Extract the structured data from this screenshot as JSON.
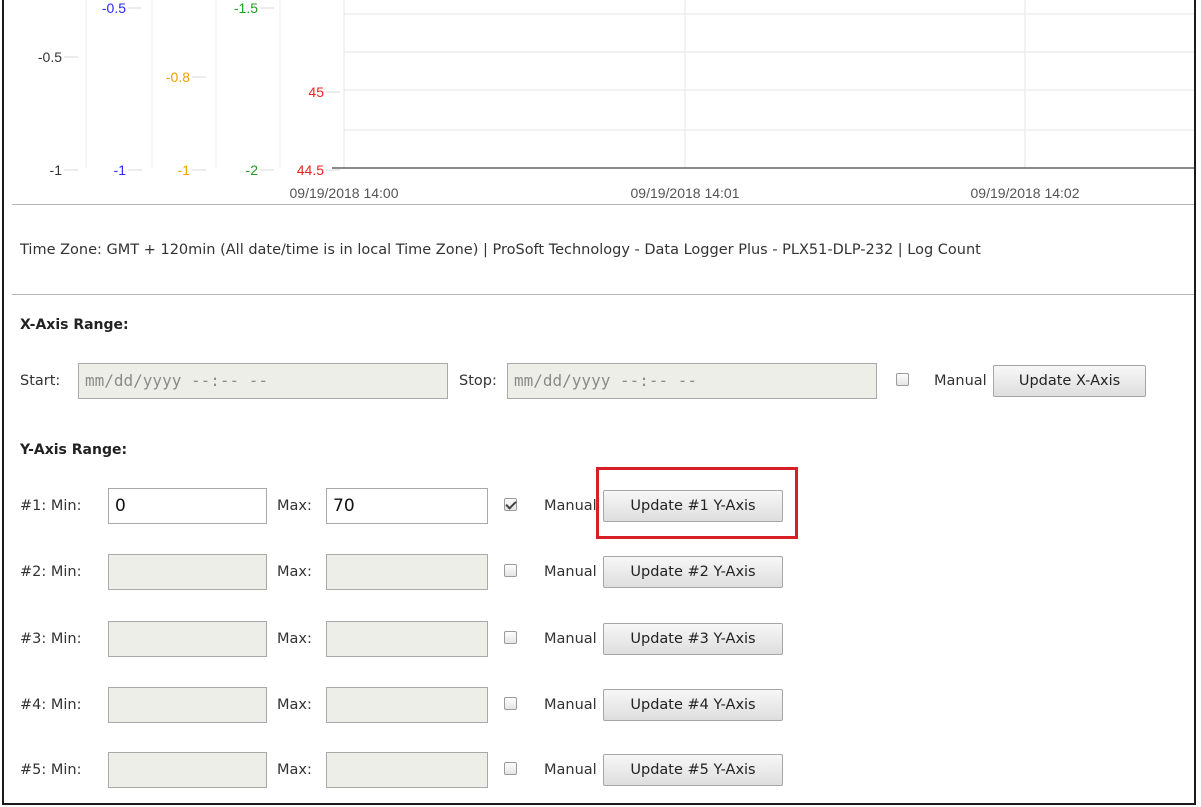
{
  "chart": {
    "y_axes": [
      {
        "ticks": [
          "-0.5",
          "-1"
        ],
        "color": "#333333"
      },
      {
        "ticks": [
          "-0.5",
          "-1"
        ],
        "color": "#2a2aff"
      },
      {
        "ticks": [
          "-0.8",
          "-1"
        ],
        "color": "#f0a000"
      },
      {
        "ticks": [
          "-1.5",
          "-2"
        ],
        "color": "#1e9e1e"
      },
      {
        "ticks": [
          "45",
          "44.5"
        ],
        "color": "#ee2222"
      }
    ],
    "x_ticks": [
      "09/19/2018 14:00",
      "09/19/2018 14:01",
      "09/19/2018 14:02"
    ]
  },
  "footer_info": "Time Zone: GMT + 120min (All date/time is in local Time Zone) | ProSoft Technology - Data Logger Plus - PLX51-DLP-232 | Log Count",
  "x_axis": {
    "title": "X-Axis Range:",
    "start_label": "Start:",
    "start_placeholder": "mm/dd/yyyy --:-- --",
    "stop_label": "Stop:",
    "stop_placeholder": "mm/dd/yyyy --:-- --",
    "manual_label": "Manual",
    "manual_checked": false,
    "update_label": "Update X-Axis"
  },
  "y_axis": {
    "title": "Y-Axis Range:",
    "rows": [
      {
        "label": "#1: Min:",
        "min": "0",
        "max_label": "Max:",
        "max": "70",
        "manual_label": "Manual",
        "manual_checked": true,
        "update_label": "Update #1 Y-Axis"
      },
      {
        "label": "#2: Min:",
        "min": "",
        "max_label": "Max:",
        "max": "",
        "manual_label": "Manual",
        "manual_checked": false,
        "update_label": "Update #2 Y-Axis"
      },
      {
        "label": "#3: Min:",
        "min": "",
        "max_label": "Max:",
        "max": "",
        "manual_label": "Manual",
        "manual_checked": false,
        "update_label": "Update #3 Y-Axis"
      },
      {
        "label": "#4: Min:",
        "min": "",
        "max_label": "Max:",
        "max": "",
        "manual_label": "Manual",
        "manual_checked": false,
        "update_label": "Update #4 Y-Axis"
      },
      {
        "label": "#5: Min:",
        "min": "",
        "max_label": "Max:",
        "max": "",
        "manual_label": "Manual",
        "manual_checked": false,
        "update_label": "Update #5 Y-Axis"
      }
    ]
  },
  "colors": {
    "highlight": "#d81e27"
  }
}
